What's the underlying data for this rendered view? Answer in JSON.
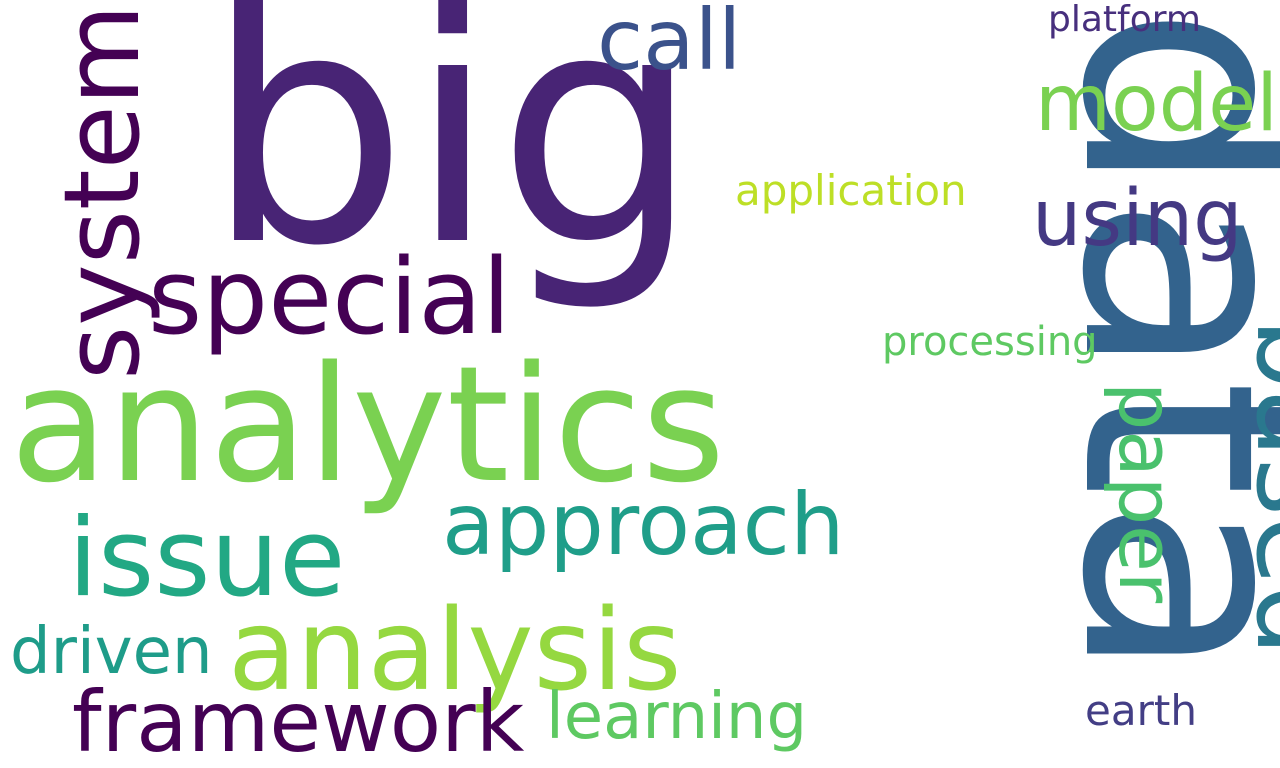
{
  "words": {
    "data": {
      "text": "data",
      "color": "#33638d"
    },
    "big": {
      "text": "big",
      "color": "#482475"
    },
    "analytics": {
      "text": "analytics",
      "color": "#7ad151"
    },
    "special": {
      "text": "special",
      "color": "#440154"
    },
    "system": {
      "text": "system",
      "color": "#440154"
    },
    "call": {
      "text": "call",
      "color": "#3b528b"
    },
    "model": {
      "text": "model",
      "color": "#7ad151"
    },
    "using": {
      "text": "using",
      "color": "#443983"
    },
    "application": {
      "text": "application",
      "color": "#bddf26"
    },
    "platform": {
      "text": "platform",
      "color": "#472f7d"
    },
    "processing": {
      "text": "processing",
      "color": "#5ec962"
    },
    "based": {
      "text": "based",
      "color": "#2a788e"
    },
    "paper": {
      "text": "paper",
      "color": "#4ac16d"
    },
    "issue": {
      "text": "issue",
      "color": "#22a884"
    },
    "approach": {
      "text": "approach",
      "color": "#1f9e89"
    },
    "analysis": {
      "text": "analysis",
      "color": "#95d840"
    },
    "driven": {
      "text": "driven",
      "color": "#1e9c89"
    },
    "framework": {
      "text": "framework",
      "color": "#440154"
    },
    "learning": {
      "text": "learning",
      "color": "#5ec962"
    },
    "earth": {
      "text": "earth",
      "color": "#433e85"
    }
  }
}
